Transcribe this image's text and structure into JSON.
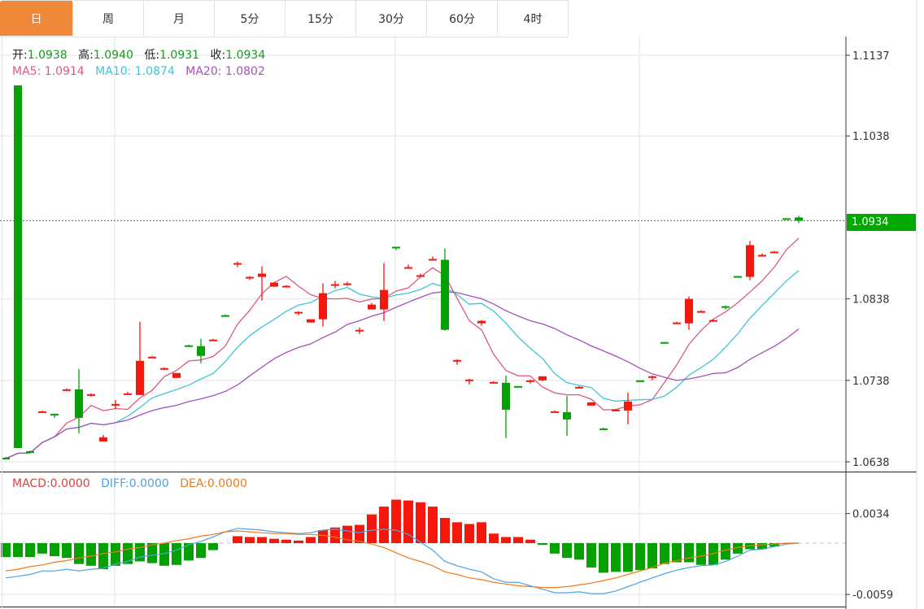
{
  "tabs": [
    "日",
    "周",
    "月",
    "5分",
    "15分",
    "30分",
    "60分",
    "4时"
  ],
  "active_tab": 0,
  "ohlc_legend": {
    "open_label": "开:",
    "open": "1.0938",
    "high_label": "高:",
    "high": "1.0940",
    "low_label": "低:",
    "low": "1.0931",
    "close_label": "收:",
    "close": "1.0934"
  },
  "ma_legend": {
    "ma5": "MA5: 1.0914",
    "ma10": "MA10: 1.0874",
    "ma20": "MA20: 1.0802"
  },
  "macd_legend": {
    "macd": "MACD:0.0000",
    "diff": "DIFF:0.0000",
    "dea": "DEA:0.0000"
  },
  "last_price": "1.0934",
  "colors": {
    "up": "#f5160c",
    "down": "#04a004",
    "ma5": "#e0587f",
    "ma10": "#3ec5d8",
    "ma20": "#a451b8",
    "diff": "#4da3e0",
    "dea": "#f07a1a",
    "accent": "#f0883a",
    "last_price": "#00a800"
  },
  "chart_data": [
    {
      "type": "candlestick",
      "title": "",
      "ylim": [
        1.0638,
        1.1137
      ],
      "yticks": [
        "1.1137",
        "1.1038",
        "1.0938",
        "1.0838",
        "1.0738",
        "1.0638"
      ],
      "ytick_labels": [
        "1.1137",
        "1.1038",
        "1.0838",
        "1.0738",
        "1.0638"
      ],
      "grid": true,
      "ma_periods": [
        5,
        10,
        20
      ],
      "candles_ohlc": [
        [
          1.0643,
          1.0644,
          1.0641,
          1.0642
        ],
        [
          1.11,
          1.11,
          1.0655,
          1.0655
        ],
        [
          1.0651,
          1.0652,
          1.0649,
          1.065
        ],
        [
          1.0699,
          1.0701,
          1.0699,
          1.07
        ],
        [
          1.0697,
          1.0697,
          1.0692,
          1.0696
        ],
        [
          1.0726,
          1.0728,
          1.0726,
          1.0727
        ],
        [
          1.0727,
          1.0752,
          1.0673,
          1.0692
        ],
        [
          1.0719,
          1.0722,
          1.0718,
          1.0721
        ],
        [
          1.0663,
          1.0671,
          1.0663,
          1.0668
        ],
        [
          1.0708,
          1.0714,
          1.0703,
          1.0709
        ],
        [
          1.0721,
          1.0724,
          1.0721,
          1.0722
        ],
        [
          1.072,
          1.081,
          1.072,
          1.0762
        ],
        [
          1.0766,
          1.0768,
          1.0765,
          1.0767
        ],
        [
          1.0752,
          1.0754,
          1.0751,
          1.0753
        ],
        [
          1.0741,
          1.0747,
          1.0741,
          1.0747
        ],
        [
          1.0781,
          1.0782,
          1.0779,
          1.078
        ],
        [
          1.078,
          1.0789,
          1.0759,
          1.0768
        ],
        [
          1.0787,
          1.0789,
          1.0787,
          1.0788
        ],
        [
          1.0818,
          1.0819,
          1.0817,
          1.0817
        ],
        [
          1.0881,
          1.0884,
          1.0877,
          1.0882
        ],
        [
          1.0864,
          1.0866,
          1.0861,
          1.0865
        ],
        [
          1.0865,
          1.0878,
          1.0836,
          1.0869
        ],
        [
          1.0853,
          1.0858,
          1.0853,
          1.0858
        ],
        [
          1.0853,
          1.0855,
          1.0853,
          1.0854
        ],
        [
          1.0821,
          1.0823,
          1.0818,
          1.0822
        ],
        [
          1.0809,
          1.0813,
          1.0809,
          1.0813
        ],
        [
          1.0813,
          1.0857,
          1.0804,
          1.0845
        ],
        [
          1.0855,
          1.086,
          1.0851,
          1.0856
        ],
        [
          1.0856,
          1.0859,
          1.0854,
          1.0857
        ],
        [
          1.0799,
          1.0803,
          1.0795,
          1.08
        ],
        [
          1.0825,
          1.0833,
          1.0825,
          1.0831
        ],
        [
          1.0825,
          1.0882,
          1.0811,
          1.0849
        ],
        [
          1.0902,
          1.0902,
          1.0898,
          1.0901
        ],
        [
          1.0876,
          1.088,
          1.0876,
          1.0877
        ],
        [
          1.0866,
          1.0869,
          1.0866,
          1.0867
        ],
        [
          1.0886,
          1.089,
          1.0886,
          1.0887
        ],
        [
          1.0886,
          1.09,
          1.0799,
          1.08
        ],
        [
          1.0762,
          1.0764,
          1.0757,
          1.0763
        ],
        [
          1.0738,
          1.074,
          1.0733,
          1.0739
        ],
        [
          1.0808,
          1.0812,
          1.0805,
          1.0811
        ],
        [
          1.0735,
          1.0737,
          1.0734,
          1.0736
        ],
        [
          1.0735,
          1.0744,
          1.0667,
          1.0702
        ],
        [
          1.0731,
          1.0731,
          1.0729,
          1.073
        ],
        [
          1.0737,
          1.0739,
          1.0734,
          1.0738
        ],
        [
          1.0738,
          1.0743,
          1.0737,
          1.0743
        ],
        [
          1.0699,
          1.0701,
          1.0699,
          1.07
        ],
        [
          1.0699,
          1.0719,
          1.067,
          1.069
        ],
        [
          1.0729,
          1.0731,
          1.0728,
          1.073
        ],
        [
          1.0707,
          1.0711,
          1.0707,
          1.0711
        ],
        [
          1.0679,
          1.068,
          1.0677,
          1.0678
        ],
        [
          1.0701,
          1.0703,
          1.07,
          1.0702
        ],
        [
          1.0701,
          1.0723,
          1.0684,
          1.0712
        ],
        [
          1.0738,
          1.0738,
          1.0736,
          1.0737
        ],
        [
          1.0742,
          1.0744,
          1.0738,
          1.0743
        ],
        [
          1.0785,
          1.0785,
          1.0783,
          1.0784
        ],
        [
          1.0808,
          1.081,
          1.0808,
          1.0809
        ],
        [
          1.0808,
          1.0841,
          1.08,
          1.0838
        ],
        [
          1.0822,
          1.0824,
          1.0822,
          1.0823
        ],
        [
          1.0811,
          1.0813,
          1.081,
          1.0812
        ],
        [
          1.0829,
          1.083,
          1.0825,
          1.0828
        ],
        [
          1.0866,
          1.0866,
          1.0864,
          1.0865
        ],
        [
          1.0865,
          1.0909,
          1.0861,
          1.0904
        ],
        [
          1.0891,
          1.0894,
          1.089,
          1.0892
        ],
        [
          1.0895,
          1.0897,
          1.0895,
          1.0896
        ],
        [
          1.0937,
          1.0937,
          1.0935,
          1.0936
        ],
        [
          1.0938,
          1.094,
          1.0931,
          1.0934
        ]
      ]
    },
    {
      "type": "bar+line",
      "title": "MACD",
      "ylim": [
        -0.0059,
        0.0034
      ],
      "ytick_labels": [
        "0.0034",
        "-0.0059"
      ],
      "macd": [
        -0.0016,
        -0.0016,
        -0.0016,
        -0.0012,
        -0.0015,
        -0.0017,
        -0.0024,
        -0.0026,
        -0.003,
        -0.0026,
        -0.0024,
        -0.0021,
        -0.0023,
        -0.0026,
        -0.0025,
        -0.002,
        -0.0017,
        -0.0008,
        0,
        0.0008,
        0.0007,
        0.0007,
        0.0005,
        0.0004,
        0.0003,
        0.0007,
        0.0015,
        0.0018,
        0.002,
        0.0021,
        0.0033,
        0.0042,
        0.005,
        0.0049,
        0.0047,
        0.0042,
        0.0029,
        0.0024,
        0.0022,
        0.0024,
        0.0011,
        0.0007,
        0.0007,
        0.0004,
        -0.0002,
        -0.0012,
        -0.0017,
        -0.0019,
        -0.0028,
        -0.0034,
        -0.0033,
        -0.0033,
        -0.0031,
        -0.0029,
        -0.0024,
        -0.0022,
        -0.0022,
        -0.0025,
        -0.0025,
        -0.0019,
        -0.0012,
        -0.0007,
        -0.0007,
        -0.0004,
        -0.0001,
        0
      ],
      "diff": [
        -0.004,
        -0.0038,
        -0.0036,
        -0.0032,
        -0.0032,
        -0.003,
        -0.0032,
        -0.003,
        -0.0029,
        -0.0024,
        -0.0021,
        -0.0016,
        -0.0014,
        -0.0012,
        -0.0008,
        -0.0002,
        0.0002,
        0.0007,
        0.0013,
        0.0017,
        0.0016,
        0.0015,
        0.0013,
        0.0012,
        0.0011,
        0.0012,
        0.0015,
        0.0016,
        0.0014,
        0.0012,
        0.0015,
        0.0016,
        0.0015,
        0.001,
        0.0001,
        -0.0008,
        -0.0021,
        -0.0026,
        -0.003,
        -0.0033,
        -0.0041,
        -0.0045,
        -0.0045,
        -0.0049,
        -0.0053,
        -0.0057,
        -0.0057,
        -0.0056,
        -0.0058,
        -0.0058,
        -0.0055,
        -0.005,
        -0.0045,
        -0.004,
        -0.0035,
        -0.0031,
        -0.0028,
        -0.0026,
        -0.0025,
        -0.0021,
        -0.0015,
        -0.0008,
        -0.0007,
        -0.0004,
        -0.0001,
        0
      ],
      "dea": [
        -0.0032,
        -0.003,
        -0.0027,
        -0.0025,
        -0.0022,
        -0.002,
        -0.0017,
        -0.0015,
        -0.0012,
        -0.001,
        -0.0007,
        -0.0005,
        -0.0002,
        0.0,
        0.0003,
        0.0005,
        0.0008,
        0.001,
        0.0013,
        0.0014,
        0.0013,
        0.0012,
        0.0011,
        0.0011,
        0.001,
        0.001,
        0.0009,
        0.0007,
        0.0004,
        0.0002,
        -0.0001,
        -0.0005,
        -0.0011,
        -0.0017,
        -0.0021,
        -0.0026,
        -0.0033,
        -0.0036,
        -0.004,
        -0.0042,
        -0.0045,
        -0.0047,
        -0.0049,
        -0.005,
        -0.0051,
        -0.0051,
        -0.005,
        -0.0048,
        -0.0046,
        -0.0043,
        -0.004,
        -0.0036,
        -0.0032,
        -0.0028,
        -0.0023,
        -0.002,
        -0.0017,
        -0.0015,
        -0.0012,
        -0.0008,
        -0.0005,
        -0.0003,
        -0.0002,
        -0.0001,
        0,
        0
      ]
    }
  ]
}
